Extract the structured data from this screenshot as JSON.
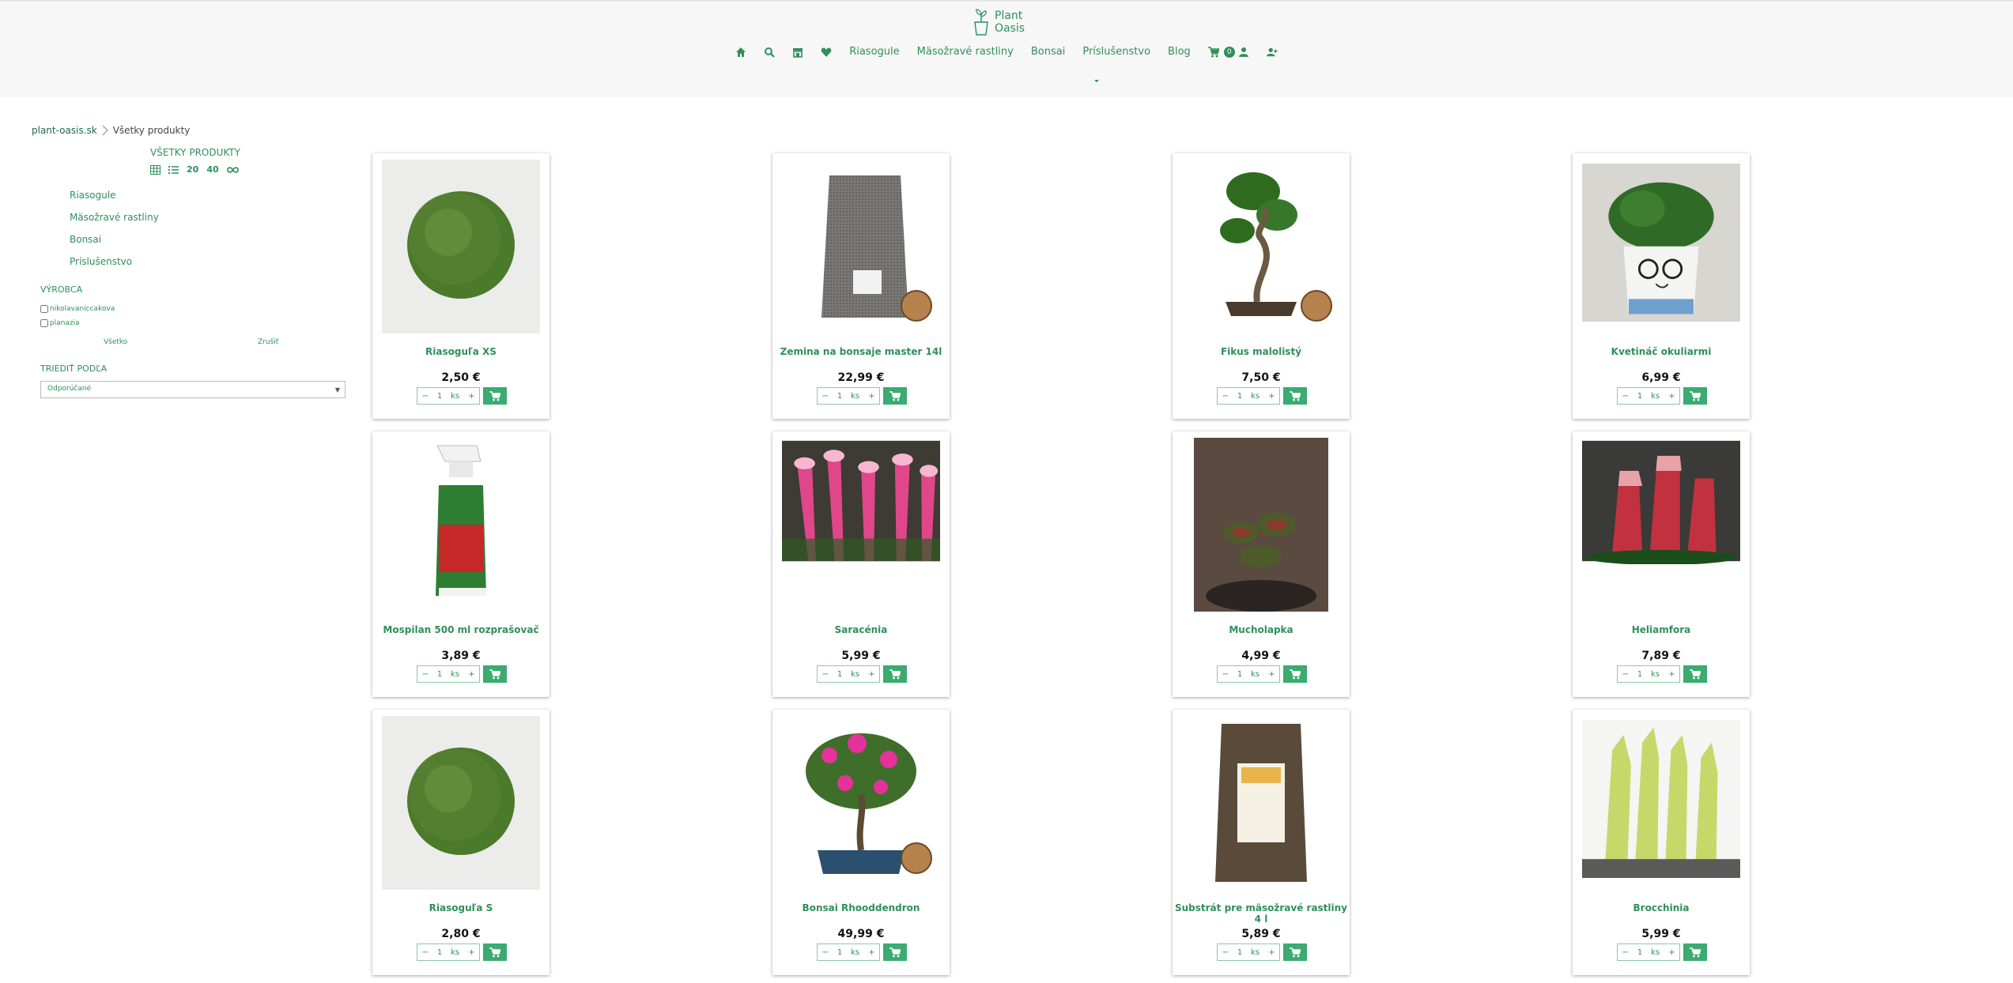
{
  "header": {
    "logo": {
      "line1": "Plant",
      "line2": "Oasis"
    },
    "nav_links": [
      "Riasogule",
      "Mäsožravé rastliny",
      "Bonsai",
      "Príslušenstvo",
      "Blog"
    ],
    "cart_count": "0",
    "icons": [
      "home-icon",
      "search-icon",
      "store-icon",
      "heart-icon",
      "cart-icon",
      "user-icon",
      "user-plus-icon",
      "chevron-down-icon"
    ]
  },
  "breadcrumb": {
    "home": "plant-oasis.sk",
    "current": "Všetky produkty"
  },
  "sidebar": {
    "title": "VŠETKY PRODUKTY",
    "view_options": [
      "20",
      "40"
    ],
    "categories": [
      "Riasogule",
      "Mäsožravé rastliny",
      "Bonsai",
      "Príslušenstvo"
    ],
    "maker_title": "VÝROBCA",
    "makers": [
      "nikolavaniccakova",
      "planazia"
    ],
    "all_label": "Všetko",
    "clear_label": "Zrušiť",
    "sort_title": "TRIEDIŤ PODĽA",
    "sort_value": "Odporúčané"
  },
  "products": [
    {
      "name": "Riasoguľa XS",
      "price": "2,50 €",
      "qty": "1",
      "unit": "ks",
      "image": "moss-ball"
    },
    {
      "name": "Zemina na bonsaje master 14l",
      "price": "22,99 €",
      "qty": "1",
      "unit": "ks",
      "image": "soil-bag"
    },
    {
      "name": "Fikus malolistý",
      "price": "7,50 €",
      "qty": "1",
      "unit": "ks",
      "image": "bonsai-ficus"
    },
    {
      "name": "Kvetináč okuliarmi",
      "price": "6,99 €",
      "qty": "1",
      "unit": "ks",
      "image": "pot-glasses"
    },
    {
      "name": "Mospilan 500 ml rozprašovač",
      "price": "3,89 €",
      "qty": "1",
      "unit": "ks",
      "image": "spray-bottle"
    },
    {
      "name": "Saracénia",
      "price": "5,99 €",
      "qty": "1",
      "unit": "ks",
      "image": "sarracenia"
    },
    {
      "name": "Mucholapka",
      "price": "4,99 €",
      "qty": "1",
      "unit": "ks",
      "image": "venus-flytrap"
    },
    {
      "name": "Heliamfora",
      "price": "7,89 €",
      "qty": "1",
      "unit": "ks",
      "image": "heliamphora"
    },
    {
      "name": "Riasoguľa S",
      "price": "2,80 €",
      "qty": "1",
      "unit": "ks",
      "image": "moss-ball"
    },
    {
      "name": "Bonsai Rhooddendron",
      "price": "49,99 €",
      "qty": "1",
      "unit": "ks",
      "image": "bonsai-rhododendron"
    },
    {
      "name": "Substrát pre mäsožravé rastliny 4 l",
      "price": "5,89 €",
      "qty": "1",
      "unit": "ks",
      "image": "substrate-bag"
    },
    {
      "name": "Brocchinia",
      "price": "5,99 €",
      "qty": "1",
      "unit": "ks",
      "image": "brocchinia"
    }
  ],
  "colors": {
    "accent": "#2f8f5b",
    "button": "#3bab6f",
    "header_bg": "#f7f7f7"
  }
}
